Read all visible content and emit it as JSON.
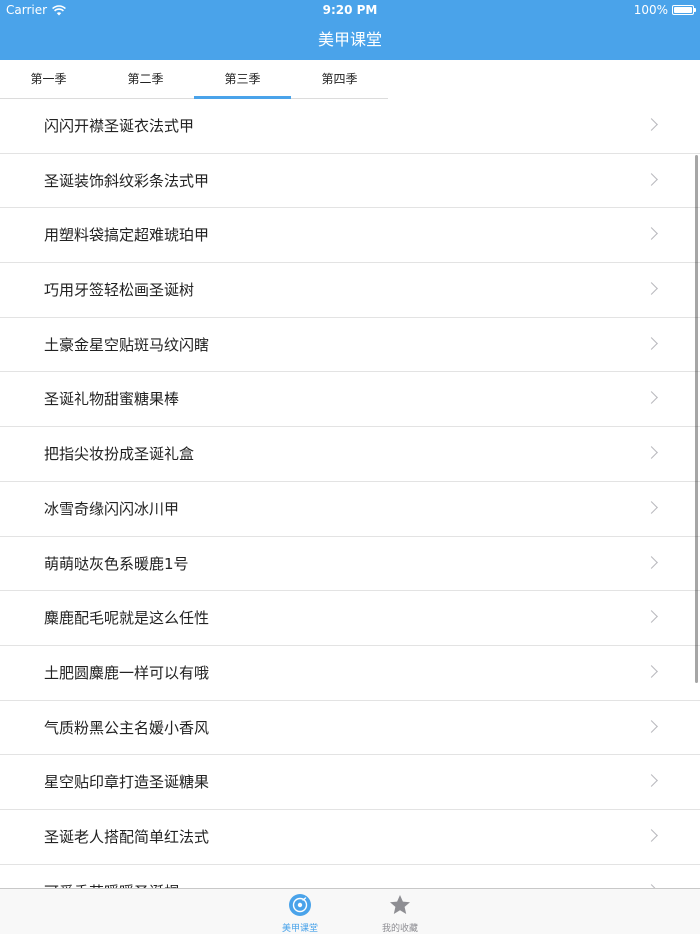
{
  "status_bar": {
    "carrier": "Carrier",
    "time": "9:20 PM",
    "battery": "100%"
  },
  "nav": {
    "title": "美甲课堂"
  },
  "tabs": [
    {
      "label": "第一季"
    },
    {
      "label": "第二季"
    },
    {
      "label": "第三季",
      "active": true
    },
    {
      "label": "第四季"
    }
  ],
  "list": {
    "items": [
      {
        "label": "闪闪开襟圣诞衣法式甲"
      },
      {
        "label": "圣诞装饰斜纹彩条法式甲"
      },
      {
        "label": "用塑料袋搞定超难琥珀甲"
      },
      {
        "label": "巧用牙签轻松画圣诞树"
      },
      {
        "label": "土豪金星空贴斑马纹闪瞎"
      },
      {
        "label": "圣诞礼物甜蜜糖果棒"
      },
      {
        "label": "把指尖妆扮成圣诞礼盒"
      },
      {
        "label": "冰雪奇缘闪闪冰川甲"
      },
      {
        "label": "萌萌哒灰色系暖鹿1号"
      },
      {
        "label": "麋鹿配毛呢就是这么任性"
      },
      {
        "label": "土肥圆麋鹿一样可以有哦"
      },
      {
        "label": "气质粉黑公主名媛小香风"
      },
      {
        "label": "星空贴印章打造圣诞糖果"
      },
      {
        "label": "圣诞老人搭配简单红法式"
      },
      {
        "label": "可爱香芋暖暖圣诞帽"
      }
    ]
  },
  "tabbar": {
    "items": [
      {
        "label": "美甲课堂",
        "icon": "disc-icon",
        "active": true
      },
      {
        "label": "我的收藏",
        "icon": "star-icon"
      }
    ]
  },
  "colors": {
    "accent": "#4aa3ea",
    "header_bg": "#4aa3ea",
    "inactive_icon": "#8e8e93"
  }
}
